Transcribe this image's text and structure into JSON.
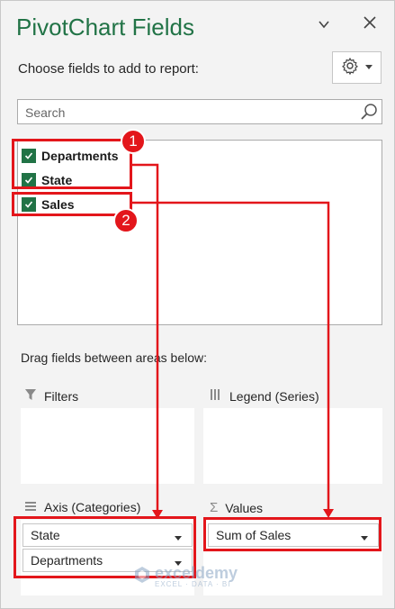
{
  "pane": {
    "title": "PivotChart Fields",
    "subtitle": "Choose fields to add to report:",
    "search_placeholder": "Search"
  },
  "fields": [
    {
      "label": "Departments",
      "checked": true
    },
    {
      "label": "State",
      "checked": true
    },
    {
      "label": "Sales",
      "checked": true
    }
  ],
  "areas_instruction": "Drag fields between areas below:",
  "areas": {
    "filters": {
      "label": "Filters",
      "items": []
    },
    "legend": {
      "label": "Legend (Series)",
      "items": []
    },
    "axis": {
      "label": "Axis (Categories)",
      "items": [
        "State",
        "Departments"
      ]
    },
    "values": {
      "label": "Values",
      "items": [
        "Sum of Sales"
      ]
    }
  },
  "annotations": {
    "badge_1": "1",
    "badge_2": "2",
    "color": "#e3161b"
  },
  "watermark": {
    "name": "exceldemy",
    "tagline": "EXCEL · DATA · BI"
  },
  "colors": {
    "title": "#217346",
    "checkbox": "#217346"
  }
}
